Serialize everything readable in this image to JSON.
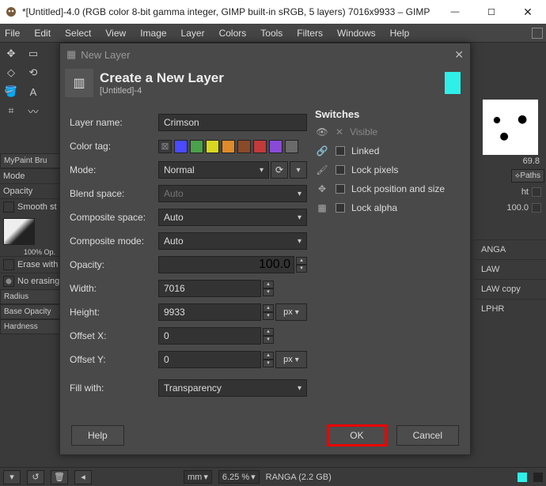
{
  "window": {
    "title": "*[Untitled]-4.0 (RGB color 8-bit gamma integer, GIMP built-in sRGB, 5 layers) 7016x9933 – GIMP"
  },
  "menu": {
    "items": [
      "File",
      "Edit",
      "Select",
      "View",
      "Image",
      "Layer",
      "Colors",
      "Tools",
      "Filters",
      "Windows",
      "Help"
    ]
  },
  "dialog": {
    "title": "New Layer",
    "heading": "Create a New Layer",
    "subtitle": "[Untitled]-4",
    "fields": {
      "layer_name_label": "Layer name:",
      "layer_name_value": "Crimson",
      "color_tag_label": "Color tag:",
      "mode_label": "Mode:",
      "mode_value": "Normal",
      "blend_space_label": "Blend space:",
      "blend_space_value": "Auto",
      "composite_space_label": "Composite space:",
      "composite_space_value": "Auto",
      "composite_mode_label": "Composite mode:",
      "composite_mode_value": "Auto",
      "opacity_label": "Opacity:",
      "opacity_value": "100.0",
      "width_label": "Width:",
      "width_value": "7016",
      "height_label": "Height:",
      "height_value": "9933",
      "height_unit": "px",
      "offset_x_label": "Offset X:",
      "offset_x_value": "0",
      "offset_y_label": "Offset Y:",
      "offset_y_value": "0",
      "offset_unit": "px",
      "fill_with_label": "Fill with:",
      "fill_with_value": "Transparency"
    },
    "color_tags": [
      "#3a3a3a",
      "#4a4aff",
      "#4aa24a",
      "#d8d820",
      "#e08a2a",
      "#8a4a2a",
      "#c23a3a",
      "#8a4ad8",
      "#6a6a6a"
    ],
    "switches": {
      "heading": "Switches",
      "visible": "Visible",
      "linked": "Linked",
      "lock_pixels": "Lock pixels",
      "lock_position": "Lock position and size",
      "lock_alpha": "Lock alpha"
    },
    "buttons": {
      "help": "Help",
      "ok": "OK",
      "cancel": "Cancel"
    }
  },
  "left_panel": {
    "mypaint": "MyPaint Bru",
    "mode": "Mode",
    "opacity": "Opacity",
    "smooth": "Smooth st",
    "op_value": "100% Op.",
    "erase_with": "Erase with",
    "no_erasing": "No erasing",
    "radius": "Radius",
    "base_opacity": "Base Opacity",
    "hardness": "Hardness"
  },
  "right_panel": {
    "brush_size": "69.8",
    "paths_tab": "Paths",
    "ht_label": "ht",
    "value_100": "100.0",
    "layers": [
      "ANGA",
      "LAW",
      "LAW copy",
      "LPHR"
    ]
  },
  "status": {
    "unit": "mm",
    "zoom": "6.25 %",
    "doc": "RANGA (2.2 GB)"
  }
}
